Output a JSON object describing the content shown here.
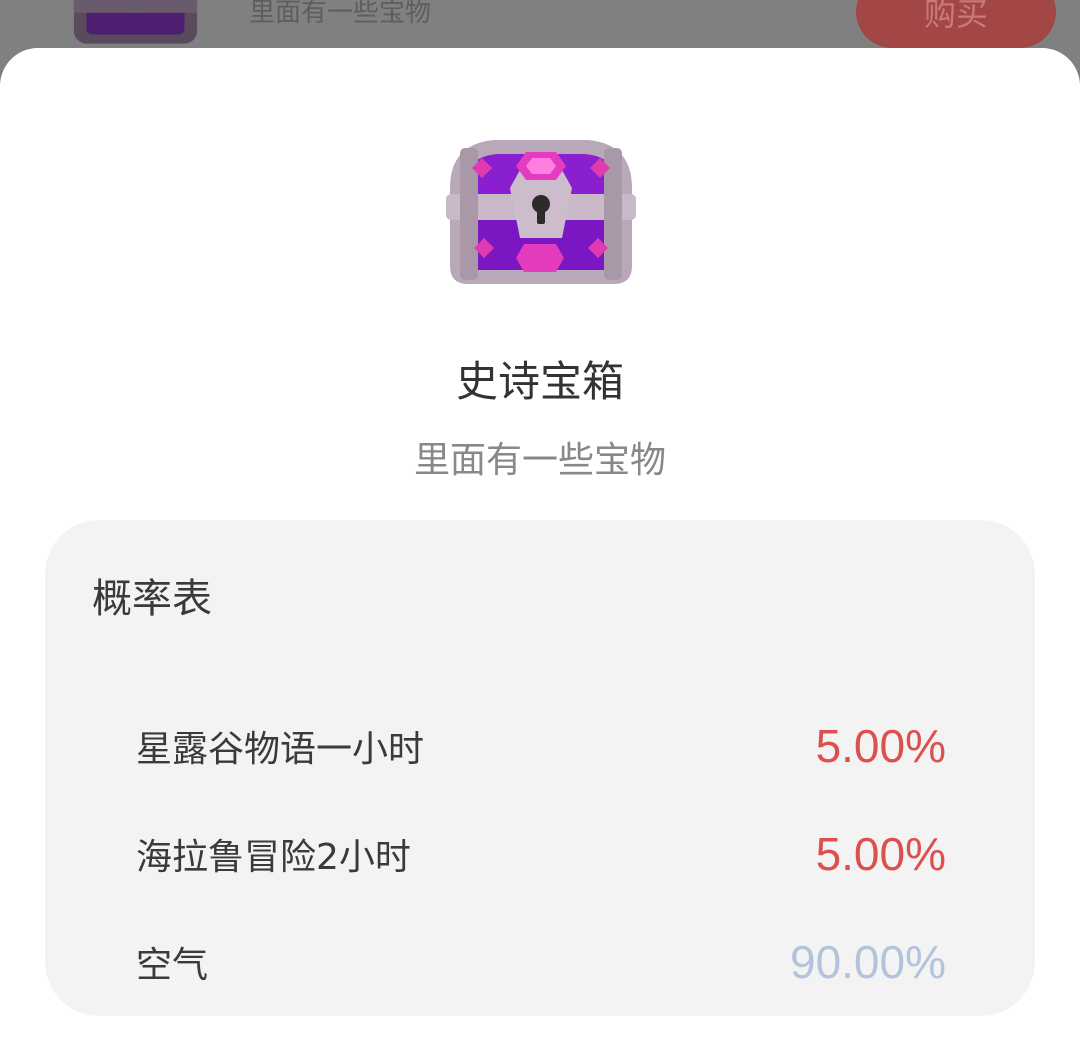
{
  "background_item": {
    "description": "里面有一些宝物",
    "buy_label": "购买",
    "icon": "epic-chest-icon"
  },
  "item": {
    "icon": "epic-chest-icon",
    "title": "史诗宝箱",
    "description": "里面有一些宝物"
  },
  "probability_table": {
    "title": "概率表",
    "rows": [
      {
        "name": "星露谷物语一小时",
        "percent": "5.00%"
      },
      {
        "name": "海拉鲁冒险2小时",
        "percent": "5.00%"
      },
      {
        "name": "空气",
        "percent": "90.00%"
      }
    ]
  },
  "colors": {
    "accent_red": "#dc5050",
    "muted_blue": "#b2c4db",
    "chest_purple": "#8a1fd0",
    "chest_frame": "#b9a8b9"
  }
}
